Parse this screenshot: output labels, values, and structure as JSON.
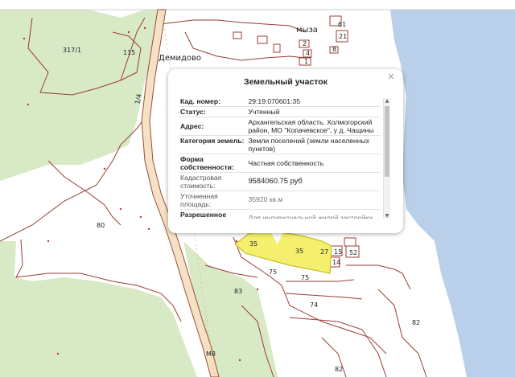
{
  "map": {
    "place_name": "Демидово",
    "place_name_partial": "мыза",
    "road_labels": [
      "1/4",
      "М8"
    ],
    "parcel_labels": [
      "317/1",
      "115",
      "80",
      "83",
      "35",
      "35",
      "75",
      "75",
      "74",
      "27",
      "15",
      "52",
      "14",
      "82",
      "82",
      "61",
      "21",
      "2",
      "4",
      "1",
      "8"
    ],
    "colors": {
      "land": "#ffffff",
      "forest": "#d8e9c6",
      "water": "#b9cfea",
      "parcel_border": "#9b3c36",
      "road_fill": "#f5e2c5",
      "road_border": "#9b4c36",
      "highlight_fill": "#f4f06e",
      "highlight_border": "#c9bd2c"
    }
  },
  "popup": {
    "title": "Земельный участок",
    "close_glyph": "×",
    "rows": [
      {
        "label": "Кад. номер:",
        "value": "29:19:070601:35"
      },
      {
        "label": "Статус:",
        "value": "Учтенный"
      },
      {
        "label": "Адрес:",
        "value": "Архангельская область, Холмогорский район, МО \"Копачевское\", у д. Чащины"
      },
      {
        "label": "Категория земель:",
        "value": "Земли поселений (земли населенных пунктов)"
      },
      {
        "label": "Форма собственности:",
        "value": "Частная собственность"
      },
      {
        "label": "Кадастровая стоимость:",
        "value": "9584060.75 руб"
      },
      {
        "label": "Уточненная площадь:",
        "value": "35920 кв.м"
      },
      {
        "label": "Разрешенное",
        "value": "Для индивидуальной жилой застройки"
      }
    ],
    "scroll_up": "▲",
    "scroll_down": "▼"
  }
}
